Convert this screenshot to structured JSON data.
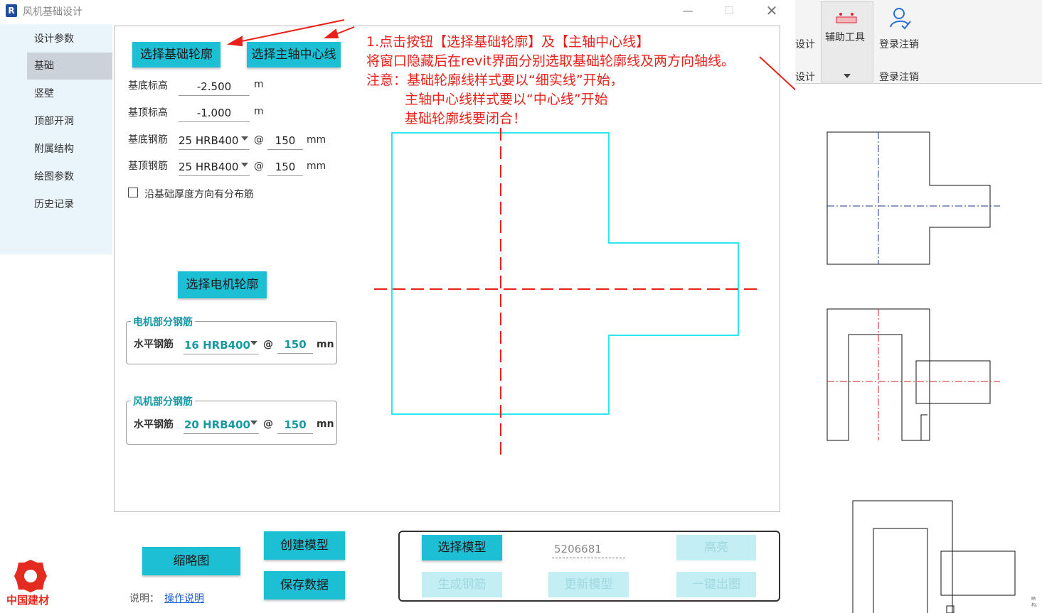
{
  "titlebar": {
    "app_icon": "R",
    "title": "风机基础设计",
    "minimize_icon": "minimize-icon",
    "maximize_icon": "maximize-icon",
    "close_icon": "close-icon"
  },
  "sidebar": {
    "items": [
      {
        "label": "设计参数",
        "active": false
      },
      {
        "label": "基础",
        "active": true
      },
      {
        "label": "竖壁",
        "active": false
      },
      {
        "label": "顶部开洞",
        "active": false
      },
      {
        "label": "附属结构",
        "active": false
      },
      {
        "label": "绘图参数",
        "active": false
      },
      {
        "label": "历史记录",
        "active": false
      }
    ]
  },
  "form": {
    "select_outline_btn": "选择基础轮廓",
    "select_axis_btn": "选择主轴中心线",
    "base_bottom_elev": {
      "label": "基底标高",
      "value": "-2.500",
      "unit": "m"
    },
    "base_top_elev": {
      "label": "基顶标高",
      "value": "-1.000",
      "unit": "m"
    },
    "bottom_rebar": {
      "label": "基底钢筋",
      "type": "25 HRB400",
      "at": "@",
      "spacing": "150",
      "unit": "mm"
    },
    "top_rebar": {
      "label": "基顶钢筋",
      "type": "25 HRB400",
      "at": "@",
      "spacing": "150",
      "unit": "mm"
    },
    "distribution_checkbox": {
      "label": "沿基础厚度方向有分布筋",
      "checked": false
    },
    "select_motor_btn": "选择电机轮廓",
    "motor_group": {
      "title": "电机部分钢筋",
      "label": "水平钢筋",
      "type": "16 HRB400",
      "at": "@",
      "spacing": "150",
      "unit": "mn"
    },
    "fan_group": {
      "title": "风机部分钢筋",
      "label": "水平钢筋",
      "type": "20 HRB400",
      "at": "@",
      "spacing": "150",
      "unit": "mn"
    }
  },
  "instructions": {
    "line1": "1.点击按钮【选择基础轮廓】及【主轴中心线】",
    "line2": "将窗口隐藏后在revit界面分别选取基础轮廓线及两方向轴线。",
    "line3": "注意：基础轮廓线样式要以“细实线”开始，",
    "line4": "主轴中心线样式要以“中心线”开始",
    "line5": "基础轮廓线要闭合！"
  },
  "bottom": {
    "thumbnail_btn": "缩略图",
    "create_model_btn": "创建模型",
    "save_data_btn": "保存数据",
    "select_model_btn": "选择模型",
    "model_id": "5206681",
    "highlight_btn": "高亮",
    "gen_rebar_btn": "生成钢筋",
    "update_model_btn": "更新模型",
    "one_click_draw_btn": "一键出图",
    "help_prefix": "说明：",
    "help_link": "操作说明",
    "brand_text": "中国建材"
  },
  "ribbon": {
    "design_label_1": "设计",
    "design_label_2": "设计",
    "aux_tools_label": "辅助工具",
    "aux_tools_icon": "ruler-tool-icon",
    "login_label": "登录注销",
    "login_group_label": "登录注销",
    "login_icon": "user-check-icon",
    "tiny_hint": "晒构。"
  },
  "colors": {
    "accent_cyan": "#1cbfd3",
    "instruction_red": "#e8221b",
    "outline_cyan": "#2ee6ee",
    "axis_red": "#e8221b",
    "sidebar_bg": "#e9f4fb"
  }
}
